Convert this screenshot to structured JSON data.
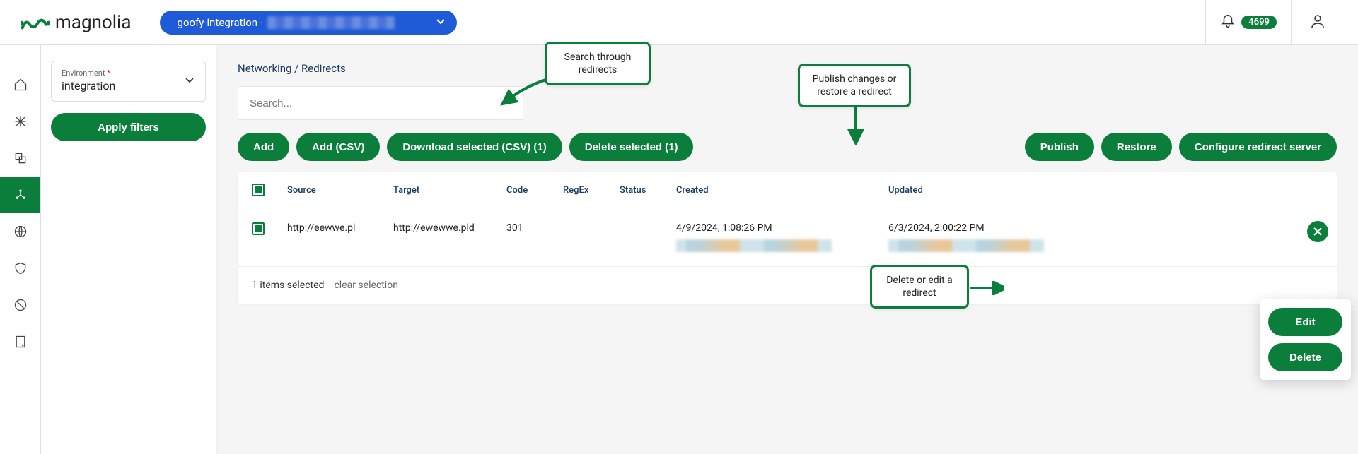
{
  "header": {
    "brand": "magnolia",
    "env_pill_prefix": "goofy-integration - ",
    "notification_count": "4699"
  },
  "sidebar": {
    "env_label": "Environment",
    "env_required_marker": "*",
    "env_value": "integration",
    "apply_label": "Apply filters"
  },
  "breadcrumb": "Networking / Redirects",
  "search": {
    "placeholder": "Search..."
  },
  "toolbar": {
    "add": "Add",
    "add_csv": "Add (CSV)",
    "download_selected": "Download selected (CSV) (1)",
    "delete_selected": "Delete selected (1)",
    "publish": "Publish",
    "restore": "Restore",
    "configure": "Configure redirect server"
  },
  "table": {
    "headers": {
      "source": "Source",
      "target": "Target",
      "code": "Code",
      "regex": "RegEx",
      "status": "Status",
      "created": "Created",
      "updated": "Updated"
    },
    "rows": [
      {
        "source": "http://eewwe.pl",
        "target": "http://ewewwe.pld",
        "code": "301",
        "regex": "",
        "status": "",
        "created": "4/9/2024, 1:08:26 PM",
        "updated": "6/3/2024, 2:00:22 PM"
      }
    ],
    "footer": {
      "selected_text": "1 items selected",
      "clear_text": "clear selection"
    }
  },
  "popover": {
    "edit": "Edit",
    "delete": "Delete"
  },
  "callouts": {
    "search": "Search through redirects",
    "publish": "Publish changes or restore a redirect",
    "edit": "Delete or edit a redirect"
  },
  "colors": {
    "accent": "#0a7e3a",
    "pill": "#1f5bd6"
  }
}
